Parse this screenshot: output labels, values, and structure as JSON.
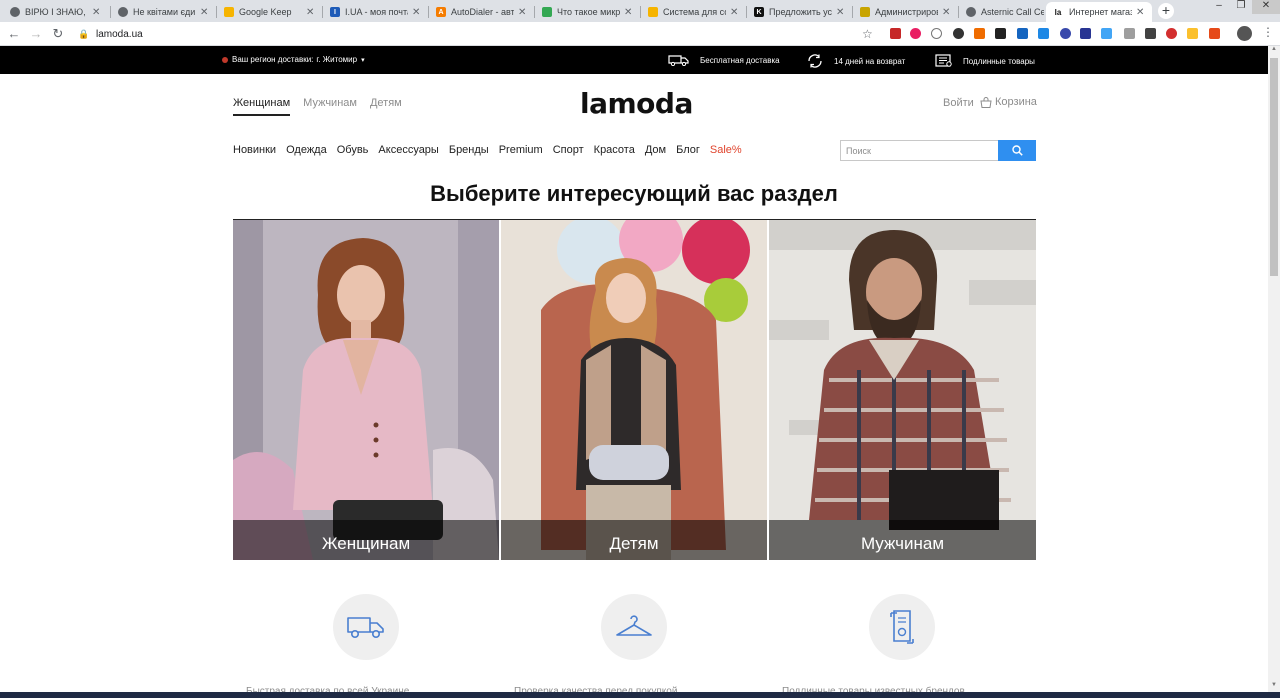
{
  "browser": {
    "tabs": [
      {
        "title": "ВІРЮ І ЗНАЮ, Uk",
        "favicon_color": "#5f6368"
      },
      {
        "title": "Не квітами єдин",
        "favicon_color": "#5f6368"
      },
      {
        "title": "Google Keep",
        "favicon_color": "#f6b400"
      },
      {
        "title": "I.UA - моя почта",
        "favicon_color": "#1e5bb8"
      },
      {
        "title": "AutoDialer - авто",
        "favicon_color": "#f57c00"
      },
      {
        "title": "Что такое микро",
        "favicon_color": "#34a853"
      },
      {
        "title": "Система для соз",
        "favicon_color": "#f6b400"
      },
      {
        "title": "Предложить усл",
        "favicon_color": "#111111"
      },
      {
        "title": "Администриров",
        "favicon_color": "#c8a400"
      },
      {
        "title": "Asternic Call Cen",
        "favicon_color": "#5f6368"
      },
      {
        "title": "Интернет магаз",
        "favicon_color": "#111111",
        "active": true
      }
    ],
    "url": "lamoda.ua"
  },
  "topbar": {
    "region_label": "Ваш регион доставки:",
    "region_city": "г. Житомир",
    "perks": [
      "Бесплатная доставка",
      "14 дней на возврат",
      "Подлинные товары"
    ]
  },
  "header": {
    "gender_tabs": [
      "Женщинам",
      "Мужчинам",
      "Детям"
    ],
    "logo": "lamoda",
    "login": "Войти",
    "cart": "Корзина"
  },
  "categories": [
    "Новинки",
    "Одежда",
    "Обувь",
    "Аксессуары",
    "Бренды",
    "Premium",
    "Спорт",
    "Красота",
    "Дом",
    "Блог",
    "Sale%"
  ],
  "search": {
    "placeholder": "Поиск"
  },
  "main": {
    "headline": "Выберите интересующий вас раздел",
    "cards": [
      "Женщинам",
      "Детям",
      "Мужчинам"
    ]
  },
  "benefits": [
    {
      "icon": "truck-icon",
      "text": "Быстрая доставка по всей Украине"
    },
    {
      "icon": "hanger-icon",
      "text": "Проверка качества перед покупкой"
    },
    {
      "icon": "certificate-icon",
      "text": "Подлинные товары известных брендов"
    }
  ],
  "colors": {
    "accent": "#2f8ff0",
    "sale": "#e0442d",
    "topbar": "#000000"
  }
}
